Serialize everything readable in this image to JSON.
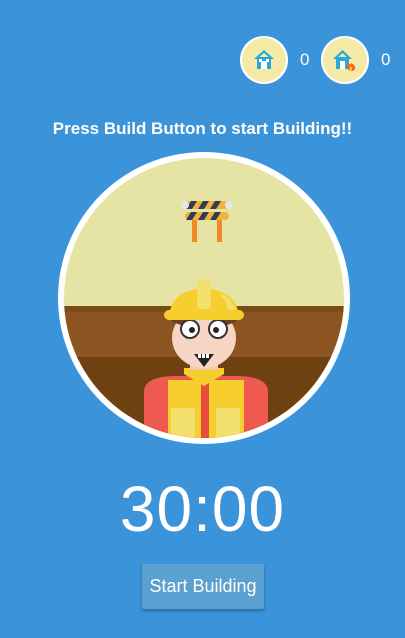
{
  "counters": {
    "built": {
      "icon": "house-icon",
      "value": "0"
    },
    "burned": {
      "icon": "house-fire-icon",
      "value": "0"
    }
  },
  "message": "Press Build Button to start Building!!",
  "scene": {
    "icons": [
      "barricade-icon",
      "construction-worker-icon"
    ]
  },
  "timer": {
    "value": "30:00"
  },
  "actions": {
    "start_label": "Start Building"
  },
  "colors": {
    "background": "#3b93d9",
    "badge": "#f3eaa7",
    "wall": "#e6e4a5",
    "floor": "#8b5420"
  }
}
